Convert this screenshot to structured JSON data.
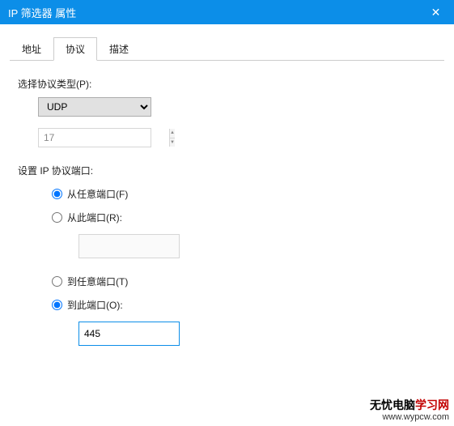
{
  "window": {
    "title": "IP 筛选器 属性"
  },
  "tabs": {
    "address": "地址",
    "protocol": "协议",
    "description": "描述"
  },
  "protocol": {
    "select_label": "选择协议类型(P):",
    "selected": "UDP",
    "number": "17",
    "port_group_label": "设置 IP 协议端口:",
    "from_any": "从任意端口(F)",
    "from_this": "从此端口(R):",
    "from_this_value": "",
    "to_any": "到任意端口(T)",
    "to_this": "到此端口(O):",
    "to_this_value": "445"
  },
  "watermark": {
    "line1_left": "无忧电脑",
    "line1_right": "学习网",
    "url": "www.wypcw.com"
  }
}
